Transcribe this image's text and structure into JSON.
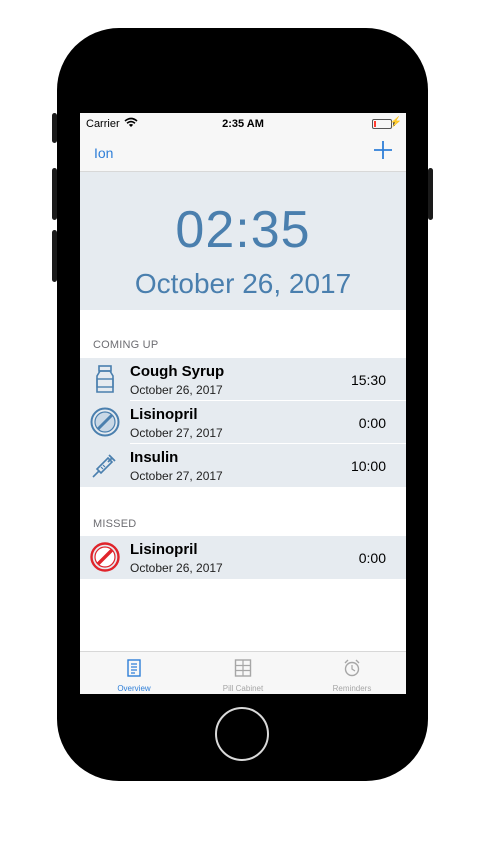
{
  "status_bar": {
    "carrier": "Carrier",
    "time": "2:35 AM",
    "battery_level": 0.1
  },
  "nav": {
    "left_label": "Ion",
    "add_icon": "plus-icon"
  },
  "hero": {
    "time": "02:35",
    "date": "October 26, 2017"
  },
  "sections": {
    "coming_up": {
      "title": "COMING UP",
      "items": [
        {
          "name": "Cough Syrup",
          "date": "October 26, 2017",
          "time": "15:30",
          "icon": "medicine-bottle-icon"
        },
        {
          "name": "Lisinopril",
          "date": "October 27, 2017",
          "time": "0:00",
          "icon": "pill-icon"
        },
        {
          "name": "Insulin",
          "date": "October 27, 2017",
          "time": "10:00",
          "icon": "syringe-icon"
        }
      ]
    },
    "missed": {
      "title": "MISSED",
      "items": [
        {
          "name": "Lisinopril",
          "date": "October 26, 2017",
          "time": "0:00",
          "icon": "pill-missed-icon"
        }
      ]
    }
  },
  "tabs": [
    {
      "label": "Overview",
      "icon": "overview-icon",
      "active": true
    },
    {
      "label": "Pill Cabinet",
      "icon": "pill-cabinet-icon",
      "active": false
    },
    {
      "label": "Reminders",
      "icon": "alarm-clock-icon",
      "active": false
    }
  ],
  "colors": {
    "accent": "#2f7fd8",
    "hero_text": "#4a7fae",
    "row_bg": "#e6ebf0",
    "missed": "#e0242b",
    "inactive_tab": "#a6a6a6"
  }
}
